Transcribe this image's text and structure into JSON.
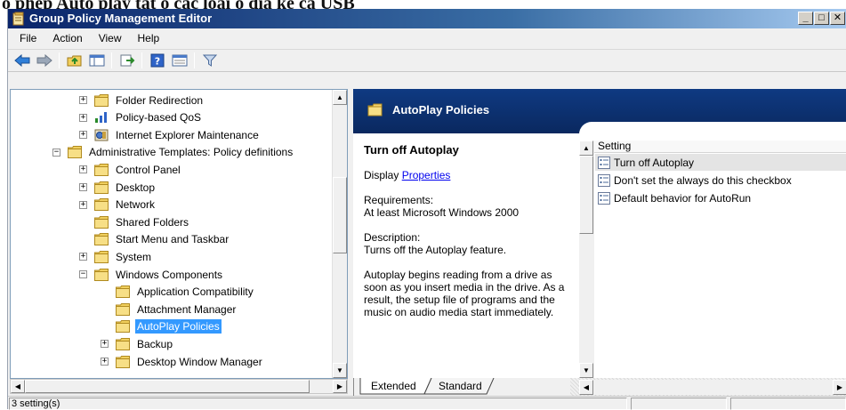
{
  "caption_fragment": "ó phép Auto play tắt ổ cắc loại ổ đĩa kể cả USB",
  "window": {
    "title": "Group Policy Management Editor",
    "controls": [
      "_",
      "□",
      "✕"
    ]
  },
  "menu": {
    "file": "File",
    "action": "Action",
    "view": "View",
    "help": "Help"
  },
  "tree": {
    "items": [
      {
        "label": "Folder Redirection",
        "expander": "+"
      },
      {
        "label": "Policy-based QoS",
        "expander": "+"
      },
      {
        "label": "Internet Explorer Maintenance",
        "expander": "+"
      },
      {
        "label": "Administrative Templates: Policy definitions",
        "expander": "−"
      },
      {
        "label": "Control Panel",
        "expander": "+"
      },
      {
        "label": "Desktop",
        "expander": "+"
      },
      {
        "label": "Network",
        "expander": "+"
      },
      {
        "label": "Shared Folders",
        "expander": ""
      },
      {
        "label": "Start Menu and Taskbar",
        "expander": ""
      },
      {
        "label": "System",
        "expander": "+"
      },
      {
        "label": "Windows Components",
        "expander": "−"
      },
      {
        "label": "Application Compatibility",
        "expander": ""
      },
      {
        "label": "Attachment Manager",
        "expander": ""
      },
      {
        "label": "AutoPlay Policies",
        "expander": ""
      },
      {
        "label": "Backup",
        "expander": "+"
      },
      {
        "label": "Desktop Window Manager",
        "expander": "+"
      }
    ]
  },
  "detail": {
    "header_title": "AutoPlay Policies",
    "policy_title": "Turn off Autoplay",
    "display_prefix": "Display ",
    "display_link": "Properties",
    "requirements_label": "Requirements:",
    "requirements_value": "At least Microsoft Windows 2000",
    "description_label": "Description:",
    "description_value": "Turns off the Autoplay feature.",
    "description_body": "Autoplay begins reading from a drive as soon as you insert media in the drive. As a result, the setup file of programs and the music on audio media start immediately."
  },
  "settings": {
    "column_header": "Setting",
    "rows": [
      "Turn off Autoplay",
      "Don't set the always do this checkbox",
      "Default behavior for AutoRun"
    ]
  },
  "tabs": {
    "extended": "Extended",
    "standard": "Standard"
  },
  "status": {
    "text": "3 setting(s)"
  },
  "colors": {
    "header_bg": "#0b2d6b",
    "selection": "#3399ff",
    "link": "#0000ee"
  }
}
